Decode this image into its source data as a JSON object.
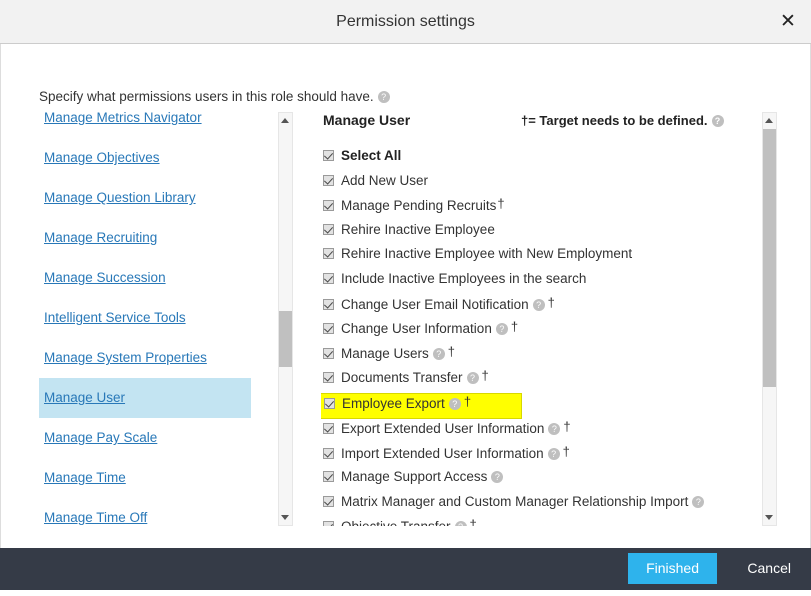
{
  "titlebar": {
    "title": "Permission settings",
    "close_label": "✕"
  },
  "instruction": {
    "text": "Specify what permissions users in this role should have.",
    "help_icon": "?"
  },
  "sidebar": {
    "items": [
      {
        "label": "Manage Metrics Navigator",
        "selected": false
      },
      {
        "label": "Manage Objectives",
        "selected": false
      },
      {
        "label": "Manage Question Library",
        "selected": false
      },
      {
        "label": "Manage Recruiting",
        "selected": false
      },
      {
        "label": "Manage Succession",
        "selected": false
      },
      {
        "label": "Intelligent Service Tools",
        "selected": false
      },
      {
        "label": "Manage System Properties",
        "selected": false
      },
      {
        "label": "Manage User",
        "selected": true
      },
      {
        "label": "Manage Pay Scale",
        "selected": false
      },
      {
        "label": "Manage Time",
        "selected": false
      },
      {
        "label": "Manage Time Off",
        "selected": false
      }
    ]
  },
  "permissions": {
    "title": "Manage User",
    "legend": "†= Target needs to be defined.",
    "legend_help_icon": "?",
    "dagger": "†",
    "items": [
      {
        "label": "Select All",
        "checked": true,
        "bold": true,
        "help": false,
        "dagger": false,
        "highlighted": false
      },
      {
        "label": "Add New User",
        "checked": true,
        "bold": false,
        "help": false,
        "dagger": false,
        "highlighted": false
      },
      {
        "label": "Manage Pending Recruits",
        "checked": true,
        "bold": false,
        "help": false,
        "dagger": true,
        "dagger_tight": true,
        "highlighted": false
      },
      {
        "label": "Rehire Inactive Employee",
        "checked": true,
        "bold": false,
        "help": false,
        "dagger": false,
        "highlighted": false
      },
      {
        "label": "Rehire Inactive Employee with New Employment",
        "checked": true,
        "bold": false,
        "help": false,
        "dagger": false,
        "highlighted": false
      },
      {
        "label": "Include Inactive Employees in the search",
        "checked": true,
        "bold": false,
        "help": false,
        "dagger": false,
        "highlighted": false
      },
      {
        "label": "Change User Email Notification",
        "checked": true,
        "bold": false,
        "help": true,
        "dagger": true,
        "highlighted": false
      },
      {
        "label": "Change User Information",
        "checked": true,
        "bold": false,
        "help": true,
        "dagger": true,
        "highlighted": false
      },
      {
        "label": "Manage Users",
        "checked": true,
        "bold": false,
        "help": true,
        "dagger": true,
        "highlighted": false
      },
      {
        "label": "Documents Transfer",
        "checked": true,
        "bold": false,
        "help": true,
        "dagger": true,
        "highlighted": false
      },
      {
        "label": "Employee Export",
        "checked": true,
        "bold": false,
        "help": true,
        "dagger": true,
        "highlighted": true
      },
      {
        "label": "Export Extended User Information",
        "checked": true,
        "bold": false,
        "help": true,
        "dagger": true,
        "highlighted": false
      },
      {
        "label": "Import Extended User Information",
        "checked": true,
        "bold": false,
        "help": true,
        "dagger": true,
        "highlighted": false
      },
      {
        "label": "Manage Support Access",
        "checked": true,
        "bold": false,
        "help": true,
        "dagger": false,
        "highlighted": false
      },
      {
        "label": "Matrix Manager and Custom Manager Relationship Import",
        "checked": true,
        "bold": false,
        "help": true,
        "dagger": false,
        "highlighted": false
      },
      {
        "label": "Objective Transfer",
        "checked": true,
        "bold": false,
        "help": true,
        "dagger": true,
        "highlighted": false
      }
    ]
  },
  "footer": {
    "finished_label": "Finished",
    "cancel_label": "Cancel"
  },
  "colors": {
    "accent": "#2eb3ec",
    "footer_bg": "#353b47",
    "link": "#2878b8",
    "selected_bg": "#c3e4f2",
    "highlight_bg": "#ffff00",
    "titlebar_bg": "#f2f2f2"
  }
}
